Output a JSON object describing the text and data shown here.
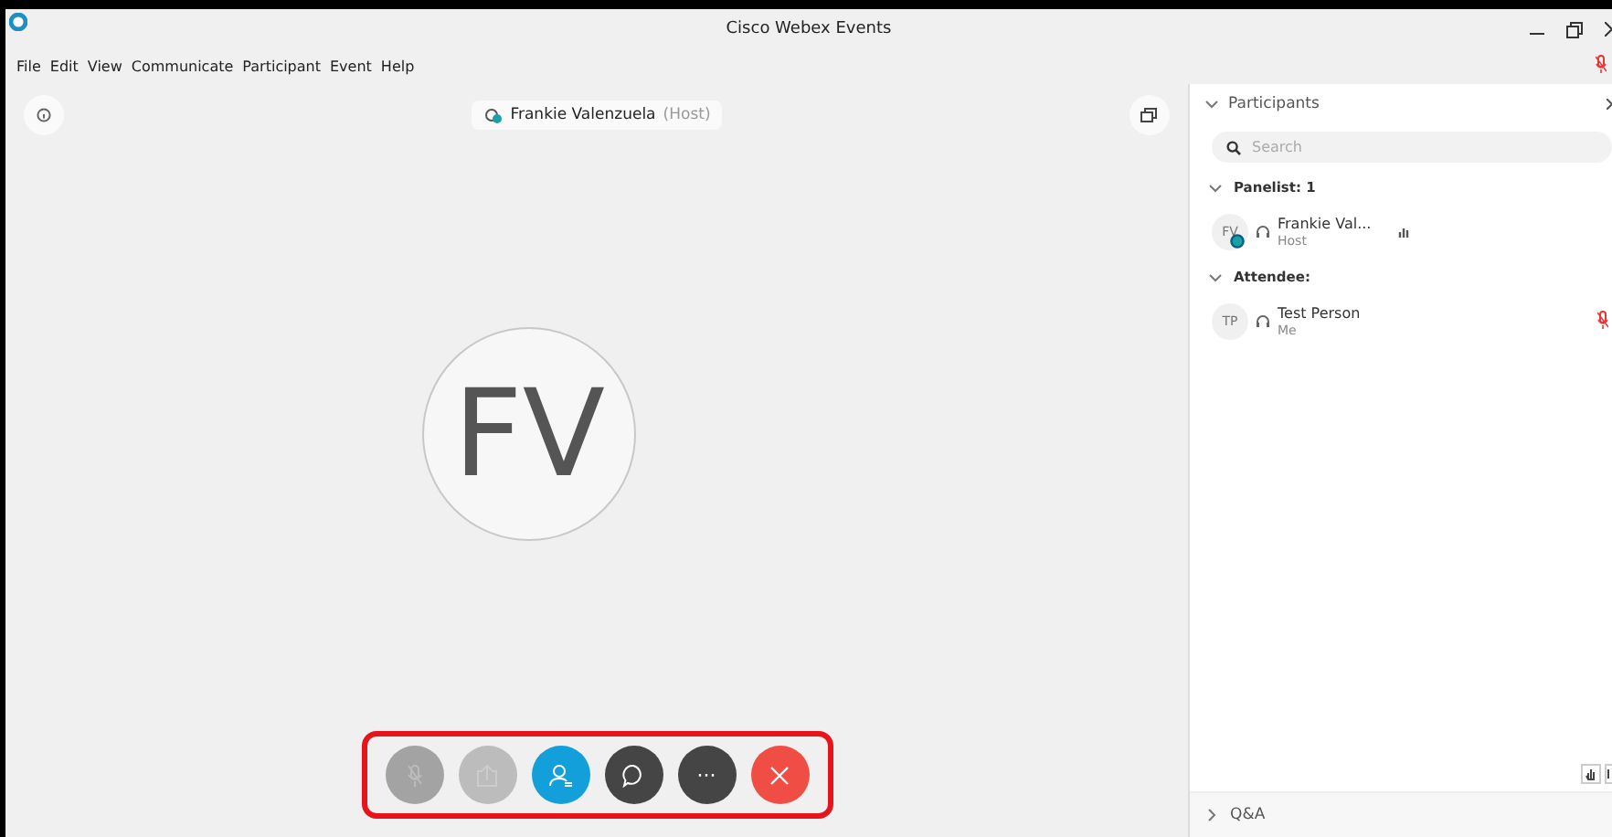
{
  "window": {
    "title": "Cisco Webex Events"
  },
  "menu": [
    "File",
    "Edit",
    "View",
    "Communicate",
    "Participant",
    "Event",
    "Help"
  ],
  "stage": {
    "presenter": {
      "name": "Frankie Valenzuela",
      "role": "(Host)"
    },
    "avatar_initials": "FV"
  },
  "controls": [
    {
      "kind": "mute",
      "disabled": true
    },
    {
      "kind": "share",
      "disabled": true
    },
    {
      "kind": "participants",
      "disabled": false,
      "selected": true
    },
    {
      "kind": "chat",
      "disabled": false,
      "selected": false
    },
    {
      "kind": "more",
      "disabled": false,
      "selected": false,
      "label": "···"
    },
    {
      "kind": "leave",
      "disabled": false,
      "selected": false
    }
  ],
  "panel": {
    "title": "Participants",
    "expanded": true,
    "search": {
      "placeholder": "Search"
    },
    "groups": [
      {
        "label": "Panelist: 1",
        "expanded": true,
        "members": [
          {
            "initials": "FV",
            "name": "Frankie Val...",
            "role": "Host",
            "presenter": true,
            "muted": false
          }
        ]
      },
      {
        "label": "Attendee:",
        "expanded": true,
        "members": [
          {
            "initials": "TP",
            "name": "Test Person",
            "role": "Me",
            "presenter": false,
            "muted": true
          }
        ]
      }
    ]
  },
  "qa": {
    "title": "Q&A",
    "expanded": false
  }
}
